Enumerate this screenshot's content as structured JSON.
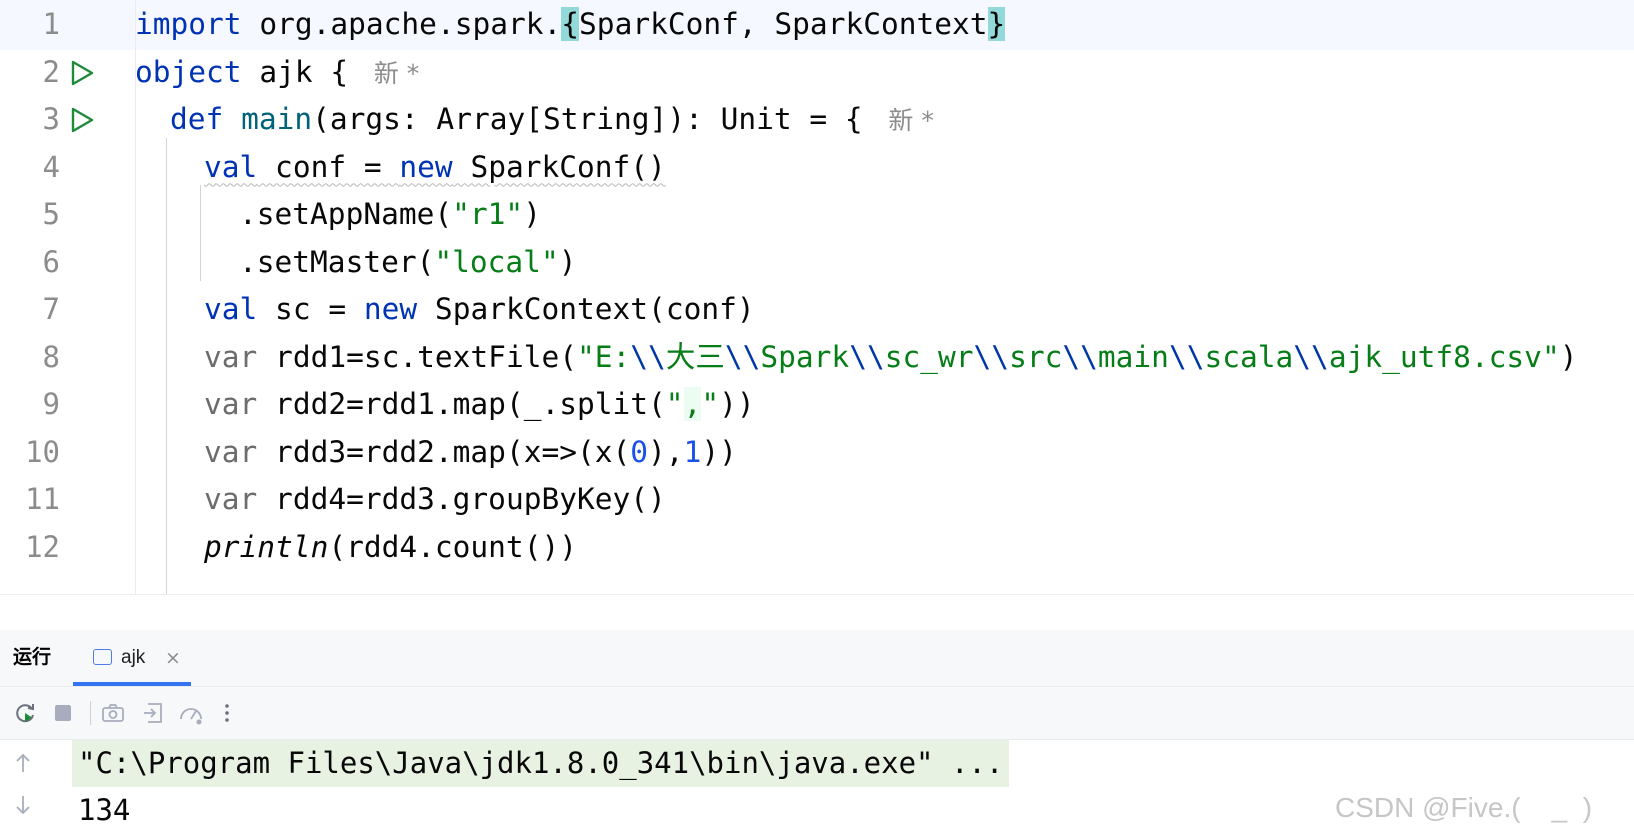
{
  "editor": {
    "lines": [
      {
        "num": "1",
        "runnable": false,
        "current": true,
        "indent": 135,
        "tokens": [
          {
            "t": "import",
            "c": "kw"
          },
          {
            "t": " org.apache.spark."
          },
          {
            "t": "{",
            "c": "brace"
          },
          {
            "t": "SparkConf, SparkContext"
          },
          {
            "t": "}",
            "c": "brace"
          }
        ]
      },
      {
        "num": "2",
        "runnable": true,
        "current": false,
        "indent": 135,
        "tokens": [
          {
            "t": "object",
            "c": "kw"
          },
          {
            "t": " ajk { "
          }
        ],
        "inlay": "新 *"
      },
      {
        "num": "3",
        "runnable": true,
        "current": false,
        "indent": 170,
        "tokens": [
          {
            "t": "def",
            "c": "kw"
          },
          {
            "t": " "
          },
          {
            "t": "main",
            "c": "fn"
          },
          {
            "t": "(args: Array[String]): Unit = { "
          }
        ],
        "inlay": "新 *"
      },
      {
        "num": "4",
        "runnable": false,
        "current": false,
        "indent": 204,
        "tokens": [
          {
            "t": "val",
            "c": "kw wavy"
          },
          {
            "t": " conf = ",
            "c": "wavy"
          },
          {
            "t": "new",
            "c": "kw wavy"
          },
          {
            "t": " SparkConf()",
            "c": "wavy"
          }
        ]
      },
      {
        "num": "5",
        "runnable": false,
        "current": false,
        "indent": 239,
        "tokens": [
          {
            "t": ".setAppName("
          },
          {
            "t": "\"r1\"",
            "c": "str"
          },
          {
            "t": ")"
          }
        ]
      },
      {
        "num": "6",
        "runnable": false,
        "current": false,
        "indent": 239,
        "tokens": [
          {
            "t": ".setMaster("
          },
          {
            "t": "\"local\"",
            "c": "str"
          },
          {
            "t": ")"
          }
        ]
      },
      {
        "num": "7",
        "runnable": false,
        "current": false,
        "indent": 204,
        "tokens": [
          {
            "t": "val",
            "c": "kw"
          },
          {
            "t": " sc = "
          },
          {
            "t": "new",
            "c": "kw"
          },
          {
            "t": " SparkContext(conf)"
          }
        ]
      },
      {
        "num": "8",
        "runnable": false,
        "current": false,
        "indent": 204,
        "tokens": [
          {
            "t": "var",
            "c": "var"
          },
          {
            "t": " rdd1=sc.textFile("
          },
          {
            "t": "\"E:",
            "c": "str"
          },
          {
            "t": "\\\\",
            "c": "esc"
          },
          {
            "t": "大三",
            "c": "str"
          },
          {
            "t": "\\\\",
            "c": "esc"
          },
          {
            "t": "Spark",
            "c": "str"
          },
          {
            "t": "\\\\",
            "c": "esc"
          },
          {
            "t": "sc_wr",
            "c": "str"
          },
          {
            "t": "\\\\",
            "c": "esc"
          },
          {
            "t": "src",
            "c": "str"
          },
          {
            "t": "\\\\",
            "c": "esc"
          },
          {
            "t": "main",
            "c": "str"
          },
          {
            "t": "\\\\",
            "c": "esc"
          },
          {
            "t": "scala",
            "c": "str"
          },
          {
            "t": "\\\\",
            "c": "esc"
          },
          {
            "t": "ajk_utf8.csv\"",
            "c": "str"
          },
          {
            "t": ")"
          }
        ]
      },
      {
        "num": "9",
        "runnable": false,
        "current": false,
        "indent": 204,
        "tokens": [
          {
            "t": "var",
            "c": "var"
          },
          {
            "t": " rdd2=rdd1.map(_.split("
          },
          {
            "t": "\"",
            "c": "str"
          },
          {
            "t": ",",
            "c": "str hl"
          },
          {
            "t": "\"",
            "c": "str"
          },
          {
            "t": "))"
          }
        ]
      },
      {
        "num": "10",
        "runnable": false,
        "current": false,
        "indent": 204,
        "tokens": [
          {
            "t": "var",
            "c": "var"
          },
          {
            "t": " rdd3=rdd2.map(x=>(x("
          },
          {
            "t": "0",
            "c": "num"
          },
          {
            "t": "),"
          },
          {
            "t": "1",
            "c": "num"
          },
          {
            "t": "))"
          }
        ]
      },
      {
        "num": "11",
        "runnable": false,
        "current": false,
        "indent": 204,
        "tokens": [
          {
            "t": "var",
            "c": "var"
          },
          {
            "t": " rdd4=rdd3.groupByKey()"
          }
        ]
      },
      {
        "num": "12",
        "runnable": false,
        "current": false,
        "indent": 204,
        "tokens": [
          {
            "t": "println",
            "c": "it"
          },
          {
            "t": "(rdd4.count())"
          }
        ]
      }
    ]
  },
  "run_panel": {
    "label": "运行",
    "tab": {
      "label": "ajk",
      "close_glyph": "×"
    },
    "toolbar": [
      {
        "icon": "rerun-icon"
      },
      {
        "icon": "stop-icon"
      },
      {
        "icon": "camera-icon"
      },
      {
        "icon": "exit-icon"
      },
      {
        "icon": "profiler-icon"
      },
      {
        "icon": "more-vertical-icon"
      }
    ],
    "console": {
      "line1": "\"C:\\Program Files\\Java\\jdk1.8.0_341\\bin\\java.exe\" ...",
      "line2": "134"
    }
  },
  "watermark": "CSDN @Five.(    _  )",
  "colors": {
    "keyword": "#0033b3",
    "string": "#067d17",
    "number": "#1750eb",
    "function": "#00627a",
    "run_gutter": "#208a3c",
    "tab_underline": "#3574f0"
  }
}
